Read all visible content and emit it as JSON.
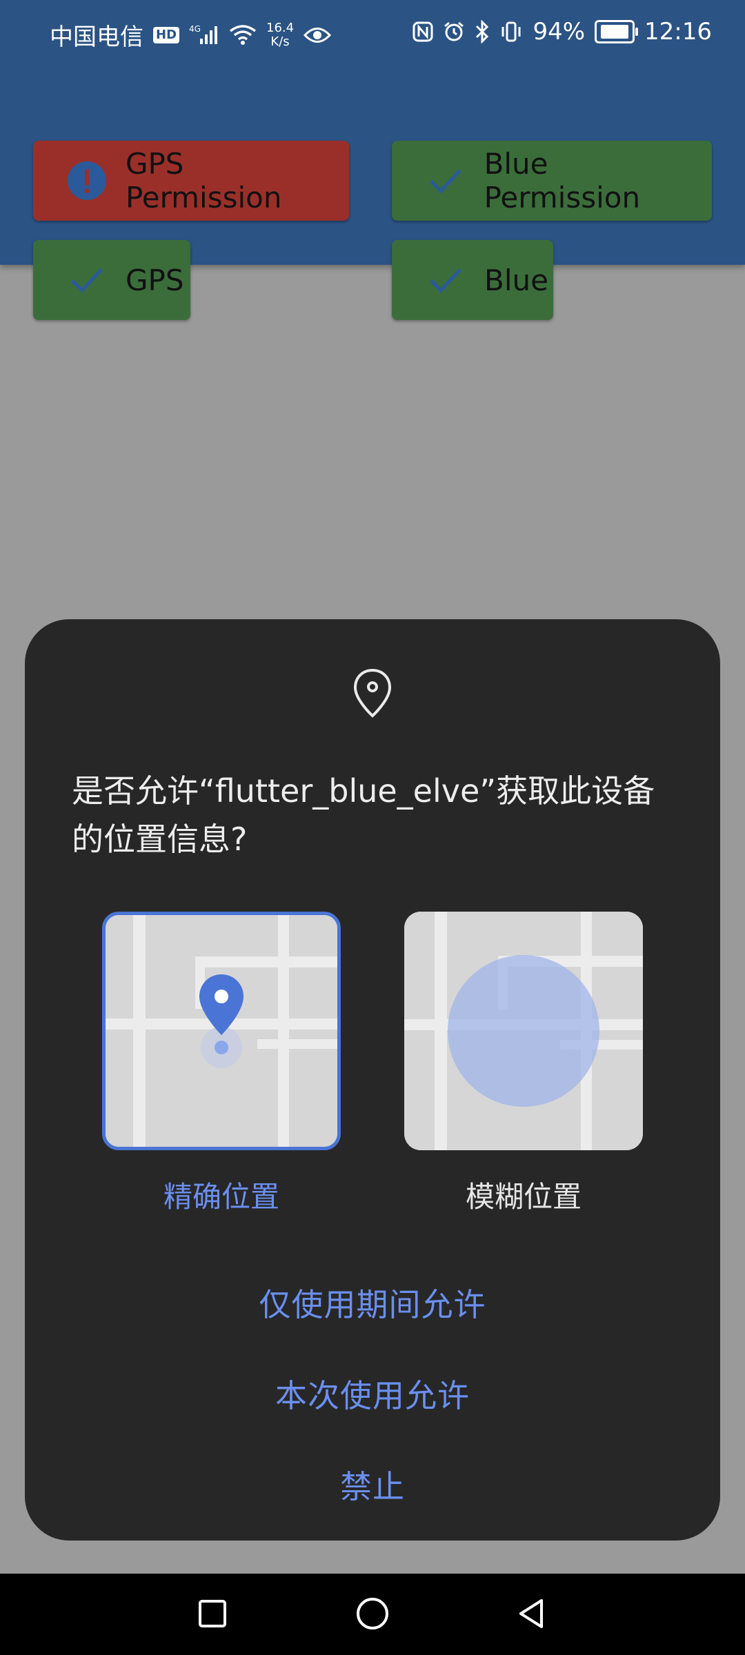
{
  "status_bar": {
    "carrier": "中国电信",
    "hd": "HD",
    "net": "4G",
    "speed_value": "16.4",
    "speed_unit": "K/s",
    "battery_percent": "94%",
    "time": "12:16"
  },
  "permissions": {
    "gps_permission": {
      "label": "GPS Permission",
      "status_color": "#9a2f2a",
      "icon": "exclamation-icon"
    },
    "blue_permission": {
      "label": "Blue Permission",
      "status_color": "#3b6d3b",
      "icon": "check-icon"
    },
    "gps": {
      "label": "GPS",
      "status_color": "#3b6d3b",
      "icon": "check-icon"
    },
    "blue": {
      "label": "Blue",
      "status_color": "#3b6d3b",
      "icon": "check-icon"
    }
  },
  "dialog": {
    "question": "是否允许“flutter_blue_elve”获取此设备的位置信息?",
    "options": {
      "precise": "精确位置",
      "approximate": "模糊位置"
    },
    "actions": {
      "while_using": "仅使用期间允许",
      "this_time": "本次使用允许",
      "deny": "禁止"
    }
  },
  "colors": {
    "accent": "#6b8ff0",
    "header": "#2b5384",
    "dialog_bg": "#272727"
  }
}
